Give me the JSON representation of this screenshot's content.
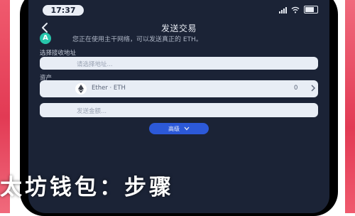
{
  "status_bar": {
    "time": "17:37"
  },
  "nav": {
    "title": "发送交易",
    "back_icon": "chevron-left-icon"
  },
  "notice": {
    "icon_letter": "A",
    "text": "您正在使用主干网络，可以发送真正的 ETH。"
  },
  "address": {
    "label": "选择接收地址",
    "placeholder": "请选择地址..."
  },
  "asset": {
    "label": "资产",
    "name": "Ether · ETH",
    "balance": "0",
    "logo": "ethereum-icon"
  },
  "amount": {
    "placeholder": "发送金额..."
  },
  "advanced": {
    "label": "高级"
  },
  "overlay": {
    "text": "太坊钱包：步骤"
  },
  "colors": {
    "accent": "#2c59d8",
    "notice": "#27c5ab",
    "background": "#1b2336",
    "side": "#e23a54"
  }
}
